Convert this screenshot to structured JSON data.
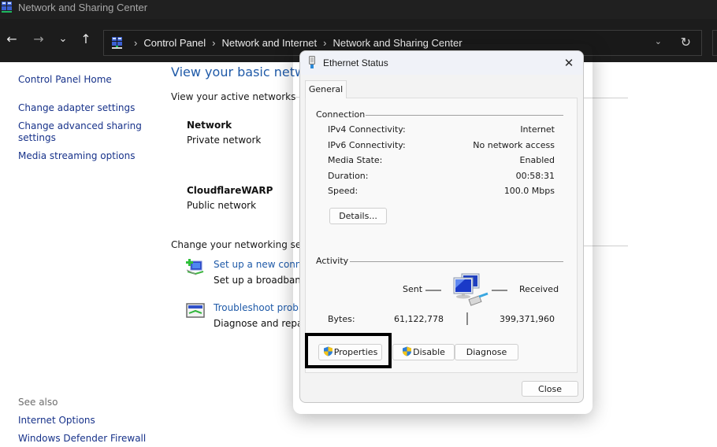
{
  "window": {
    "title": "Network and Sharing Center",
    "app_icon": "network-center-icon"
  },
  "navigation": {
    "back_icon": "arrow-left-icon",
    "forward_icon": "arrow-right-icon",
    "recent_icon": "chevron-down-icon",
    "up_icon": "arrow-up-icon",
    "back_glyph": "←",
    "forward_glyph": "→",
    "recent_glyph": "⌄",
    "up_glyph": "↑",
    "breadcrumb": [
      "Control Panel",
      "Network and Internet",
      "Network and Sharing Center"
    ],
    "breadcrumb_sep": "›",
    "dropdown_glyph": "⌄",
    "refresh_glyph": "↻"
  },
  "left_pane": {
    "links": [
      {
        "label": "Control Panel Home"
      },
      {
        "label": "Change adapter settings"
      },
      {
        "label": "Change advanced sharing"
      },
      {
        "label": "settings"
      },
      {
        "label": "Media streaming options"
      }
    ],
    "see_also_label": "See also",
    "see_also_links": [
      {
        "label": "Internet Options"
      },
      {
        "label": "Windows Defender Firewall"
      }
    ]
  },
  "main": {
    "title": "View your basic networ",
    "active_networks_label": "View your active networks",
    "networks": [
      {
        "name": "Network",
        "type": "Private network"
      },
      {
        "name": "CloudflareWARP",
        "type": "Public network"
      }
    ],
    "change_settings_label": "Change your networking settin",
    "tasks": [
      {
        "icon": "new-connection-icon",
        "link": "Set up a new connec",
        "desc": "Set up a broadband,"
      },
      {
        "icon": "troubleshoot-icon",
        "link": "Troubleshoot probler",
        "desc": "Diagnose and repair"
      }
    ]
  },
  "dialog": {
    "title": "Ethernet Status",
    "close_glyph": "✕",
    "tab": "General",
    "connection": {
      "label": "Connection",
      "rows": [
        {
          "label": "IPv4 Connectivity:",
          "value": "Internet"
        },
        {
          "label": "IPv6 Connectivity:",
          "value": "No network access"
        },
        {
          "label": "Media State:",
          "value": "Enabled"
        },
        {
          "label": "Duration:",
          "value": "00:58:31"
        },
        {
          "label": "Speed:",
          "value": "100.0 Mbps"
        }
      ],
      "details_button": "Details..."
    },
    "activity": {
      "label": "Activity",
      "sent_label": "Sent",
      "received_label": "Received",
      "bytes_label": "Bytes:",
      "bytes_sent": "61,122,778",
      "bytes_received": "399,371,960"
    },
    "buttons": {
      "properties": "Properties",
      "disable": "Disable",
      "diagnose": "Diagnose",
      "close": "Close"
    }
  },
  "colors": {
    "titlebar_bg": "#202020",
    "navbar_bg": "#1c1c1c",
    "link_blue": "#1f5aa8",
    "nav_link": "#17328a",
    "shield_blue": "#2d7fd8",
    "shield_yellow": "#f5c518",
    "highlight": "#000000"
  }
}
